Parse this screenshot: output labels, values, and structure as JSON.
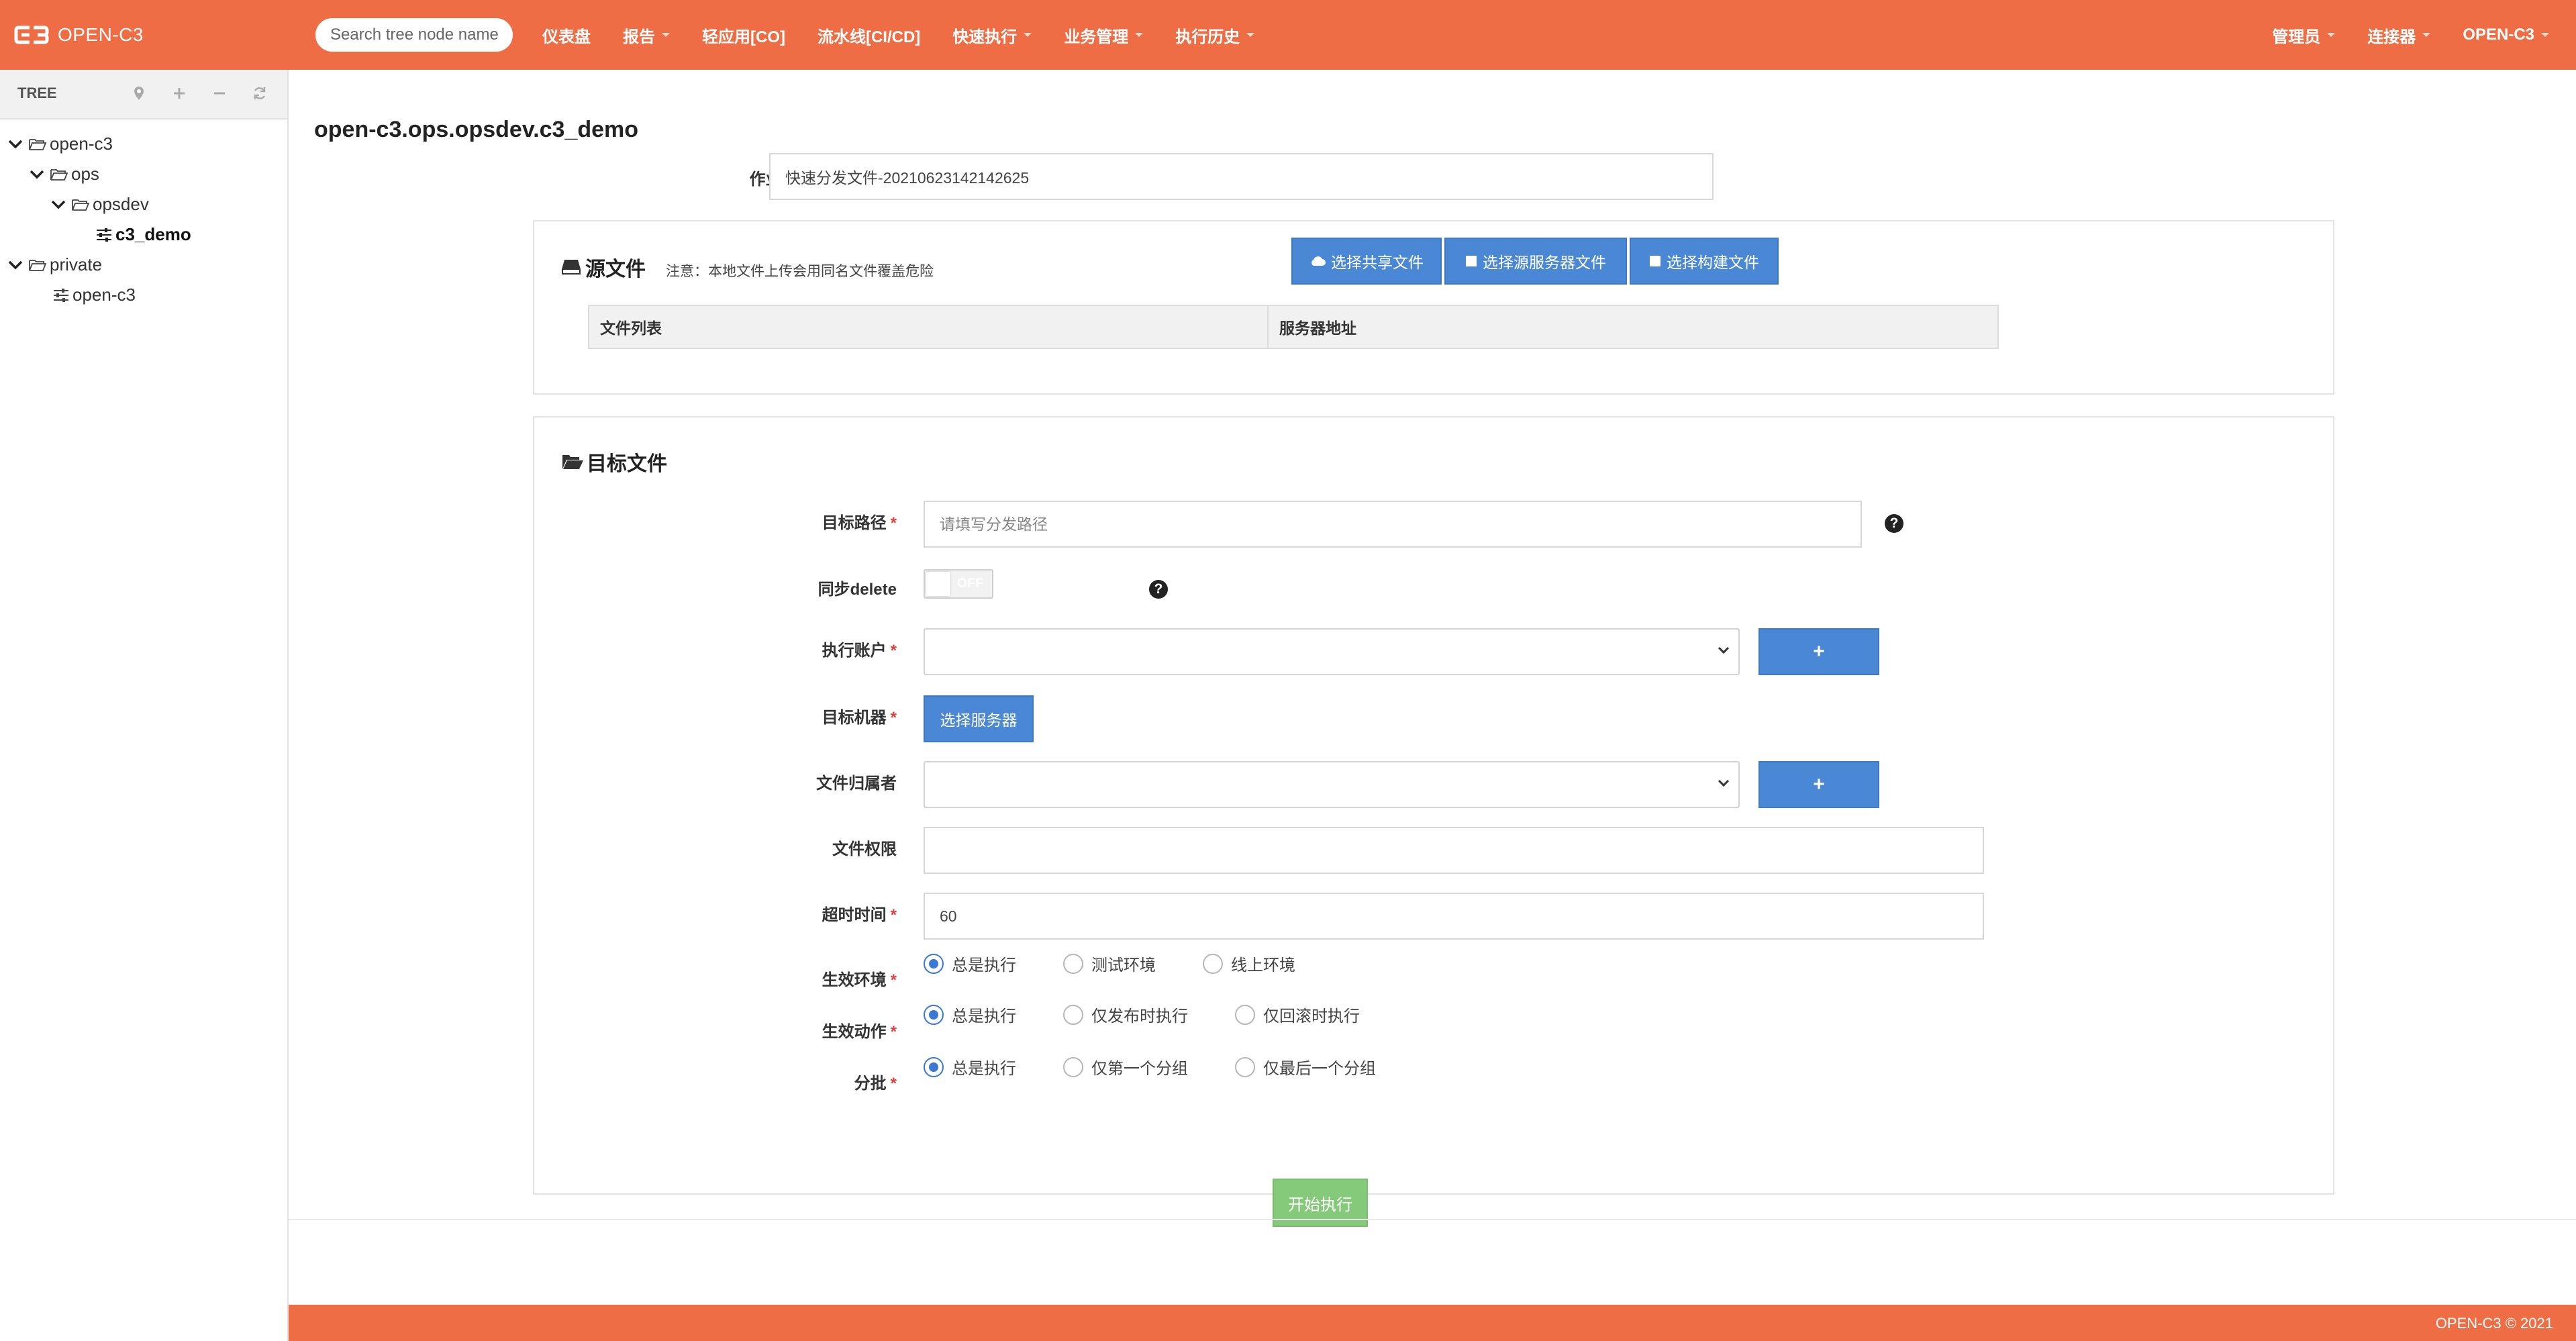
{
  "brand": {
    "name": "OPEN-C3"
  },
  "search": {
    "placeholder": "Search tree node name"
  },
  "nav": {
    "left": [
      {
        "label": "仪表盘",
        "dropdown": false
      },
      {
        "label": "报告",
        "dropdown": true
      },
      {
        "label": "轻应用[CO]",
        "dropdown": false
      },
      {
        "label": "流水线[CI/CD]",
        "dropdown": false
      },
      {
        "label": "快速执行",
        "dropdown": true
      },
      {
        "label": "业务管理",
        "dropdown": true
      },
      {
        "label": "执行历史",
        "dropdown": true
      }
    ],
    "right": [
      {
        "label": "管理员",
        "dropdown": true
      },
      {
        "label": "连接器",
        "dropdown": true
      },
      {
        "label": "OPEN-C3",
        "dropdown": true
      }
    ]
  },
  "sidebar": {
    "title": "TREE",
    "tools": [
      "pin-icon",
      "plus-icon",
      "minus-icon",
      "refresh-icon"
    ],
    "nodes": [
      {
        "label": "open-c3",
        "depth": 0,
        "type": "folder",
        "expanded": true
      },
      {
        "label": "ops",
        "depth": 1,
        "type": "folder",
        "expanded": true
      },
      {
        "label": "opsdev",
        "depth": 2,
        "type": "folder",
        "expanded": true
      },
      {
        "label": "c3_demo",
        "depth": 3,
        "type": "leaf",
        "active": true
      },
      {
        "label": "private",
        "depth": 0,
        "type": "folder",
        "expanded": true
      },
      {
        "label": "open-c3",
        "depth": 1,
        "type": "leaf"
      }
    ]
  },
  "page": {
    "title": "open-c3.ops.opsdev.c3_demo",
    "job_name_label": "作业名称",
    "job_name_value": "快速分发文件-20210623142142625"
  },
  "source": {
    "title": "源文件",
    "note": "注意：本地文件上传会用同名文件覆盖危险",
    "buttons": {
      "shared": "选择共享文件",
      "server": "选择源服务器文件",
      "build": "选择构建文件"
    },
    "table_headers": [
      "文件列表",
      "服务器地址"
    ]
  },
  "target": {
    "title": "目标文件",
    "path_label": "目标路径",
    "path_placeholder": "请填写分发路径",
    "sync_delete_label": "同步delete",
    "sync_delete_state": "OFF",
    "account_label": "执行账户",
    "add_label": "+",
    "machine_label": "目标机器",
    "machine_button": "选择服务器",
    "owner_label": "文件归属者",
    "perm_label": "文件权限",
    "perm_value": "",
    "timeout_label": "超时时间",
    "timeout_value": "60",
    "env_label": "生效环境",
    "env_options": [
      "总是执行",
      "测试环境",
      "线上环境"
    ],
    "env_selected": 0,
    "action_label": "生效动作",
    "action_options": [
      "总是执行",
      "仅发布时执行",
      "仅回滚时执行"
    ],
    "action_selected": 0,
    "batch_label": "分批",
    "batch_options": [
      "总是执行",
      "仅第一个分组",
      "仅最后一个分组"
    ],
    "batch_selected": 0,
    "start_button": "开始执行"
  },
  "footer": {
    "text": "OPEN-C3 © 2021"
  },
  "colors": {
    "brand": "#ef6d44",
    "primary": "#4a88d6",
    "success": "#85c97a",
    "required": "#e04141"
  }
}
